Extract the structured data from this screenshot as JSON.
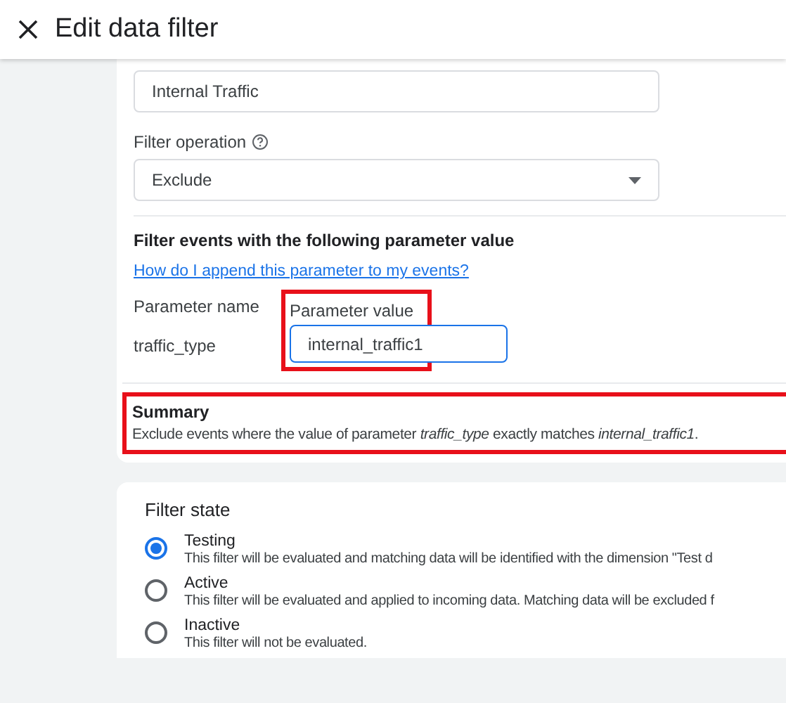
{
  "header": {
    "title": "Edit data filter"
  },
  "name_field": {
    "value": "Internal Traffic"
  },
  "operation": {
    "label": "Filter operation",
    "value": "Exclude"
  },
  "parameter": {
    "heading": "Filter events with the following parameter value",
    "help_link": "How do I append this parameter to my events?",
    "name_label": "Parameter name",
    "value_label": "Parameter value",
    "name": "traffic_type",
    "value": "internal_traffic1",
    "highlighted": true
  },
  "summary": {
    "title": "Summary",
    "text": "Exclude events where the value of parameter *traffic_type* exactly matches *internal_traffic1*.",
    "highlighted": true
  },
  "filter_state": {
    "title": "Filter state",
    "options": [
      {
        "label": "Testing",
        "description": "This filter will be evaluated and matching data will be identified with the dimension \"Test d",
        "selected": true
      },
      {
        "label": "Active",
        "description": "This filter will be evaluated and applied to incoming data. Matching data will be excluded f",
        "selected": false
      },
      {
        "label": "Inactive",
        "description": "This filter will not be evaluated.",
        "selected": false
      }
    ]
  }
}
